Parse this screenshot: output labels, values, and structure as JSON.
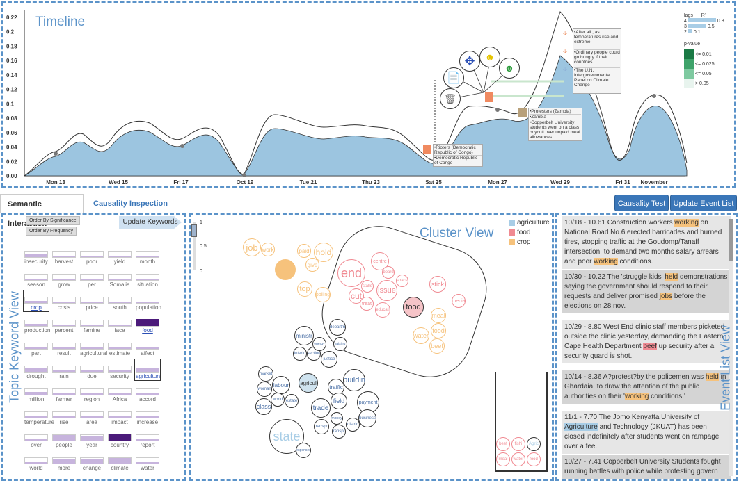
{
  "timeline": {
    "title": "Timeline",
    "y_ticks": [
      "0.22",
      "0.2",
      "0.18",
      "0.16",
      "0.14",
      "0.12",
      "0.1",
      "0.08",
      "0.06",
      "0.04",
      "0.02",
      "0.00"
    ],
    "x_ticks": [
      "Mon 13",
      "Wed 15",
      "Fri 17",
      "Oct 19",
      "Tue 21",
      "Thu 23",
      "Sat 25",
      "Mon 27",
      "Wed 29",
      "Fri 31",
      "November"
    ],
    "legend": {
      "lags_label": "lags",
      "r2_label": "R²",
      "lag_rows": [
        {
          "lag": "4",
          "value": "0.8"
        },
        {
          "lag": "3",
          "value": "0.5"
        },
        {
          "lag": "2",
          "value": "0.1"
        }
      ],
      "pvalue_label": "p-value",
      "pvalue_rows": [
        "<= 0.01",
        "<= 0.025",
        "<= 0.05",
        "> 0.05"
      ],
      "pvalue_colors": [
        "#1a7a45",
        "#3ea36a",
        "#7ec9a0",
        "#e8f4ee"
      ]
    },
    "annotations": {
      "rioters": [
        "•Rioters (Democratic Republic of Congo)",
        "•Democratic Republic of Congo"
      ],
      "protesters": [
        "•Protesters (Zambia)",
        "•Zambia",
        "•Copperbelt University students went on a class boycott over unpaid meal allowances."
      ],
      "top": [
        "•After all , as temperatures rise and extreme",
        "•Ordinary people could go hungry if their countries",
        "•The U.N. Intergovernmental Panel on Climate Change"
      ]
    },
    "fill_color": "#9cc5e0"
  },
  "tabs": {
    "semantic": "Semantic Interaction",
    "causality": "Causality Inspection"
  },
  "buttons": {
    "causality_test": "Causality Test",
    "update_event_list": "Update Event List",
    "update_keywords": "Update Keywords",
    "order_significance": "Order By Significance",
    "order_frequency": "Order By Frequency"
  },
  "topic_view": {
    "title": "Topic Keyword View",
    "slider_ticks": [
      "1",
      "0.5",
      "0"
    ],
    "keywords": [
      [
        "insecurity",
        "harvest",
        "poor",
        "yield",
        "month"
      ],
      [
        "season",
        "grow",
        "per",
        "Somalia",
        "situation"
      ],
      [
        "crop",
        "crisis",
        "price",
        "south",
        "population"
      ],
      [
        "production",
        "percent",
        "famine",
        "face",
        "food"
      ],
      [
        "part",
        "result",
        "agricultural",
        "estimate",
        "affect"
      ],
      [
        "drought",
        "rain",
        "due",
        "security",
        "agriculture"
      ],
      [
        "million",
        "farmer",
        "region",
        "Africa",
        "accord"
      ],
      [
        "temperature",
        "rise",
        "area",
        "impact",
        "increase"
      ],
      [
        "over",
        "people",
        "year",
        "country",
        "report"
      ],
      [
        "world",
        "more",
        "change",
        "climate",
        "water"
      ]
    ]
  },
  "cluster_view": {
    "title": "Cluster View",
    "legend": [
      {
        "label": "agriculture",
        "color": "#a8cde6"
      },
      {
        "label": "food",
        "color": "#f08a92"
      },
      {
        "label": "crop",
        "color": "#f6c27c"
      }
    ],
    "words": {
      "job": "job",
      "work": "work",
      "crop": "crop",
      "paid": "paid",
      "hold": "hold",
      "give": "give",
      "top": "top",
      "polling": "polling",
      "end": "end",
      "centre": "centre",
      "cut": "cut",
      "issue": "issue",
      "treat": "treat",
      "educati": "educati",
      "board": "board",
      "space": "space",
      "stalle": "stalle",
      "stick": "stick",
      "media": "media",
      "food": "food",
      "meal": "meal",
      "food2": "food",
      "water": "water",
      "beef": "beef",
      "ministr": "ministr",
      "deport": "departm",
      "agricul": "agricul",
      "labour": "labour",
      "market": "market",
      "justice": "justice",
      "buildin": "buildin",
      "traffic": "traffic",
      "field": "field",
      "trade": "trade",
      "payment": "payment",
      "class": "class",
      "state": "state",
      "transpo": "transpo",
      "expenses": "expenses",
      "business": "business",
      "world": "world",
      "estate": "estate",
      "womam": "woman",
      "interio": "interio",
      "section": "section",
      "distric": "distric",
      "transport": "transpo",
      "money": "money",
      "energy": "energy",
      "raising": "raising",
      "g_beef": "beef",
      "g_fishi": "fishi",
      "g_agric": "Agric",
      "g_meal": "meal",
      "g_water": "water",
      "g_food": "food"
    }
  },
  "event_view": {
    "title": "Event List View",
    "events": [
      {
        "pre": "10/18 - 10.61 Construction workers ",
        "hl1": "working",
        "mid": " on National Road No.6 erected barricades and burned tires, stopping traffic at the Goudomp/Tanaff intersection, to demand two months salary arrears and poor ",
        "hl2": "working",
        "post": " conditions."
      },
      {
        "pre": "10/30 - 10.22 The 'struggle kids' ",
        "hl1": "held",
        "mid": " demonstrations saying the government should respond to their requests and deliver promised ",
        "hl2": "jobs",
        "post": " before the elections on 28 nov."
      },
      {
        "pre": "10/29 - 8.80 West End clinic staff members picketed outside the clinic yesterday, demanding the Eastern Cape Health Department ",
        "hl1": "beef",
        "mid": " up security after a security guard is shot.",
        "hl2": "",
        "post": ""
      },
      {
        "pre": "10/14 - 8.36 A?protest?by the policemen was ",
        "hl1": "held",
        "mid": " in Ghardaia, to draw the attention of the public authorities on their '",
        "hl2": "working",
        "post": " conditions.'"
      },
      {
        "pre": "11/1 - 7.70 The Jomo Kenyatta University of ",
        "hl1": "Agriculture",
        "mid": " and Technology (JKUAT) has been closed indefinitely after students went on rampage over a fee.",
        "hl2": "",
        "post": ""
      },
      {
        "pre": "10/27 - 7.41 Copperbelt University Students fought running battles with police while protesting govern",
        "hl1": "",
        "mid": "",
        "hl2": "",
        "post": ""
      }
    ]
  }
}
